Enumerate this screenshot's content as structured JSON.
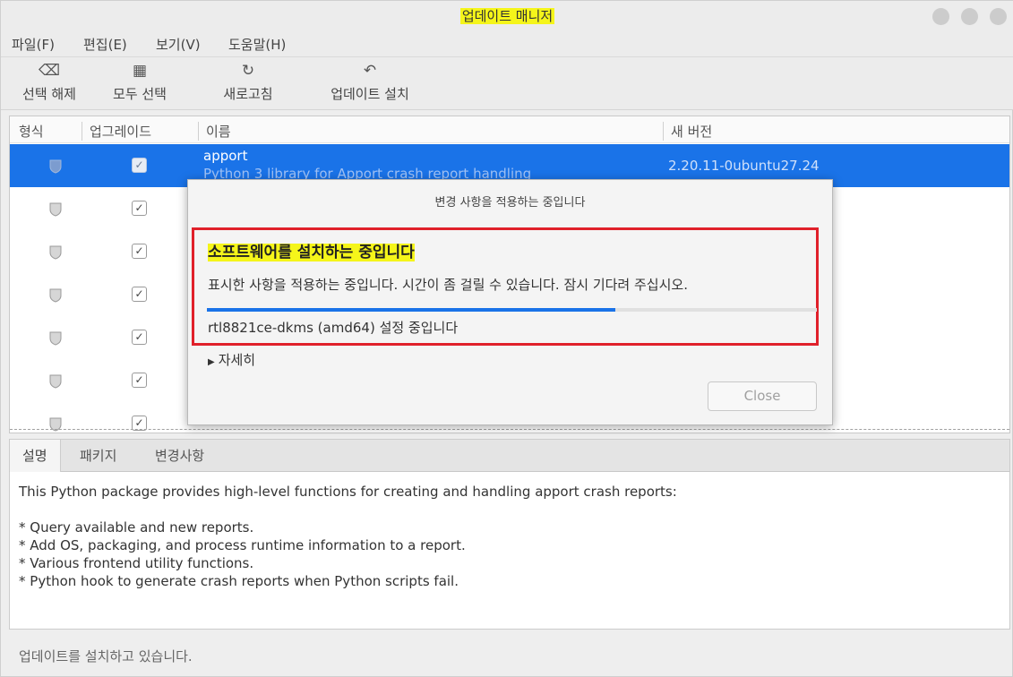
{
  "window": {
    "title": "업데이트 매니저"
  },
  "menu": [
    "파일(F)",
    "편집(E)",
    "보기(V)",
    "도움말(H)"
  ],
  "toolbar": {
    "clear_label": "선택 해제",
    "select_all_label": "모두 선택",
    "refresh_label": "새로고침",
    "install_label": "업데이트 설치",
    "clear_icon": "⌫",
    "select_all_icon": "▦",
    "refresh_icon": "↻",
    "install_icon": "↶"
  },
  "list": {
    "headers": {
      "type": "형식",
      "upgrade": "업그레이드",
      "name": "이름",
      "new_version": "새 버전"
    },
    "rows": [
      {
        "name": "apport",
        "description": "Python 3 library for Apport crash report handling",
        "version": "2.20.11-0ubuntu27.24",
        "checked": true,
        "selected": true
      },
      {
        "checked": true,
        "selected": false
      },
      {
        "checked": true,
        "selected": false
      },
      {
        "checked": true,
        "selected": false
      },
      {
        "checked": true,
        "selected": false
      },
      {
        "checked": true,
        "selected": false
      },
      {
        "checked": true,
        "selected": false
      }
    ]
  },
  "tabs": [
    "설명",
    "패키지",
    "변경사항"
  ],
  "description": {
    "intro": "This Python package provides high-level functions for creating and handling apport crash reports:",
    "bullets": [
      "* Query available and new reports.",
      "* Add OS, packaging, and process runtime information to a report.",
      "* Various frontend utility functions.",
      "* Python hook to generate crash reports when Python scripts fail."
    ]
  },
  "status": "업데이트를 설치하고 있습니다.",
  "dialog": {
    "title": "변경 사항을 적용하는 중입니다",
    "heading": "소프트웨어를 설치하는 중입니다",
    "message": "표시한 사항을 적용하는 중입니다. 시간이 좀 걸릴 수 있습니다. 잠시 기다려 주십시오.",
    "progress": 0.67,
    "status": "rtl8821ce-dkms (amd64) 설정 중입니다",
    "details_label": "자세히",
    "close_label": "Close"
  },
  "colors": {
    "accent": "#1a73e8",
    "highlight": "#f5f51a",
    "annotation_box": "#e0202a"
  }
}
